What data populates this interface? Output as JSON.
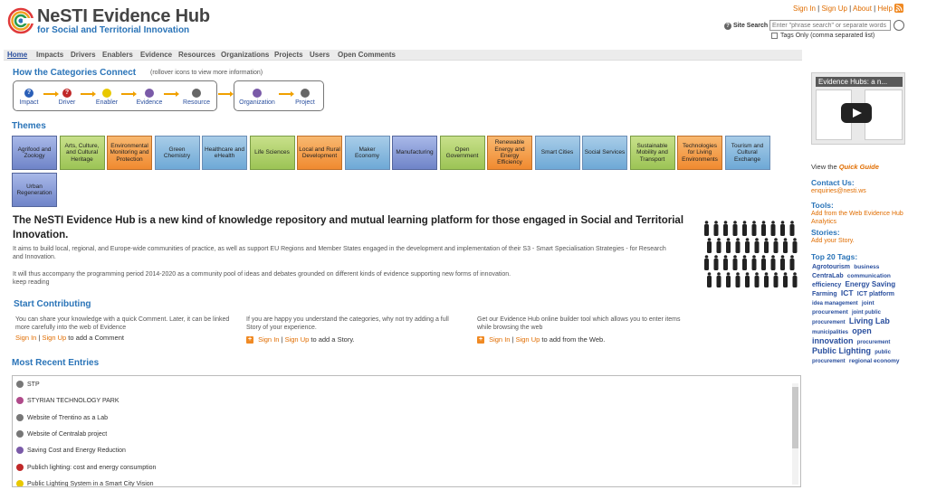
{
  "header": {
    "logo_title": "NeSTI Evidence Hub",
    "logo_subtitle": "for Social and Territorial Innovation",
    "sign_in": "Sign In",
    "sign_up": "Sign Up",
    "about": "About",
    "help": "Help",
    "site_search_label": "Site Search",
    "search_placeholder": "Enter \"phrase search\" or separate words",
    "tags_only_label": "Tags Only (comma separated list)"
  },
  "nav": [
    "Home",
    "Impacts",
    "Drivers",
    "Enablers",
    "Evidence",
    "Resources",
    "Organizations",
    "Projects",
    "Users",
    "Open Comments"
  ],
  "categories": {
    "title": "How the Categories Connect",
    "hint": "(rollover icons to view more information)",
    "flow": [
      {
        "label": "Impact",
        "icon": "question-icon",
        "color": "#2a5fb8"
      },
      {
        "label": "Driver",
        "icon": "question-icon",
        "color": "#c02828"
      },
      {
        "label": "Enabler",
        "icon": "bulb-icon",
        "color": "#e8c800"
      },
      {
        "label": "Evidence",
        "icon": "evidence-icon",
        "color": "#7a5aa8"
      },
      {
        "label": "Resource",
        "icon": "resource-icon",
        "color": "#666666"
      }
    ],
    "flow2": [
      {
        "label": "Organization",
        "icon": "organization-icon",
        "color": "#7a5aa8"
      },
      {
        "label": "Project",
        "icon": "project-icon",
        "color": "#666666"
      }
    ]
  },
  "themes": {
    "title": "Themes",
    "items": [
      {
        "label": "Agrifood and Zoology",
        "style": "purple"
      },
      {
        "label": "Arts, Culture, and Cultural Heritage",
        "style": "green"
      },
      {
        "label": "Environmental Monitoring and Protection",
        "style": "orange"
      },
      {
        "label": "Green Chemistry",
        "style": "blue"
      },
      {
        "label": "Healthcare and eHealth",
        "style": "blue"
      },
      {
        "label": "Life Sciences",
        "style": "green"
      },
      {
        "label": "Local and Rural Development",
        "style": "orange"
      },
      {
        "label": "Maker Economy",
        "style": "blue"
      },
      {
        "label": "Manufacturing",
        "style": "purple"
      },
      {
        "label": "Open Government",
        "style": "green"
      },
      {
        "label": "Renewable Energy and Energy Efficiency",
        "style": "orange"
      },
      {
        "label": "Smart Cities",
        "style": "blue"
      },
      {
        "label": "Social Services",
        "style": "blue"
      },
      {
        "label": "Sustainable Mobility and Transport",
        "style": "green"
      },
      {
        "label": "Technologies for Living Environments",
        "style": "orange"
      },
      {
        "label": "Tourism and Cultural Exchange",
        "style": "blue"
      },
      {
        "label": "Urban Regeneration",
        "style": "purple"
      }
    ]
  },
  "intro": {
    "heading": "The NeSTI Evidence Hub is a new kind of knowledge repository and mutual learning platform for those engaged in Social and Territorial Innovation.",
    "para1": "It aims to build local, regional, and Europe-wide communities of practice, as well as support EU Regions and Member States engaged in the development and implementation of their S3 - Smart Specialisation Strategies - for Research and Innovation.",
    "para2": "It will thus accompany the programming period 2014-2020 as a community pool of ideas and debates grounded on different kinds of evidence supporting new forms of innovation.",
    "keep_reading": "keep reading"
  },
  "contributing": {
    "title": "Start Contributing",
    "col1_text": "You can share your knowledge with a quick Comment. Later, it can be linked more carefully into the web of Evidence",
    "col1_action": "to add a Comment",
    "col2_text": "If you are happy you understand the categories, why not try adding a full Story of your experience.",
    "col2_action": "to add a Story.",
    "col3_text": "Get our Evidence Hub online builder tool which allows you to enter items while browsing the web",
    "col3_action": "to add from the Web.",
    "sign_in": "Sign In",
    "sign_up": "Sign Up",
    "sep": "|"
  },
  "recent": {
    "title": "Most Recent Entries",
    "entries": [
      {
        "label": "STP",
        "icon": "resource-icon",
        "color": "#777777"
      },
      {
        "label": "STYRIAN TECHNOLOGY PARK",
        "icon": "organization-icon",
        "color": "#b04a8a"
      },
      {
        "label": "Website of Trentino as a Lab",
        "icon": "resource-icon",
        "color": "#777777"
      },
      {
        "label": "Website of Centralab project",
        "icon": "resource-icon",
        "color": "#777777"
      },
      {
        "label": "Saving Cost and Energy Reduction",
        "icon": "evidence-icon",
        "color": "#7a5aa8"
      },
      {
        "label": "Publich lighting: cost and energy consumption",
        "icon": "question-icon",
        "color": "#c02828"
      },
      {
        "label": "Public Lighting System in a Smart City Vision",
        "icon": "bulb-icon",
        "color": "#e8c800"
      }
    ]
  },
  "sidebar": {
    "video_title": "Evidence Hubs: a n...",
    "view_the": "View the",
    "quick_guide": "Quick Guide",
    "contact_title": "Contact Us:",
    "contact_email": "enquiries@nesti.ws",
    "tools_title": "Tools:",
    "tools_link": "Add from the Web Evidence Hub Analytics",
    "stories_title": "Stories:",
    "stories_link": "Add your Story.",
    "tags_title": "Top 20 Tags:",
    "tags": [
      {
        "t": "Agrotourism",
        "s": 7
      },
      {
        "t": "business",
        "s": 6.5
      },
      {
        "t": "CentraLab",
        "s": 7
      },
      {
        "t": "communication",
        "s": 6.5
      },
      {
        "t": "efficiency",
        "s": 7
      },
      {
        "t": "Energy Saving",
        "s": 8
      },
      {
        "t": "Farming",
        "s": 7
      },
      {
        "t": "ICT",
        "s": 8.5
      },
      {
        "t": "ICT platform",
        "s": 7
      },
      {
        "t": "idea management",
        "s": 6
      },
      {
        "t": "joint procurement",
        "s": 6.5
      },
      {
        "t": "joint public procurement",
        "s": 6
      },
      {
        "t": "Living Lab",
        "s": 9
      },
      {
        "t": "municipalities",
        "s": 6
      },
      {
        "t": "open innovation",
        "s": 9
      },
      {
        "t": "procurement",
        "s": 6
      },
      {
        "t": "Public Lighting",
        "s": 9
      },
      {
        "t": "public procurement",
        "s": 6
      },
      {
        "t": "regional economy",
        "s": 6.5
      }
    ]
  }
}
